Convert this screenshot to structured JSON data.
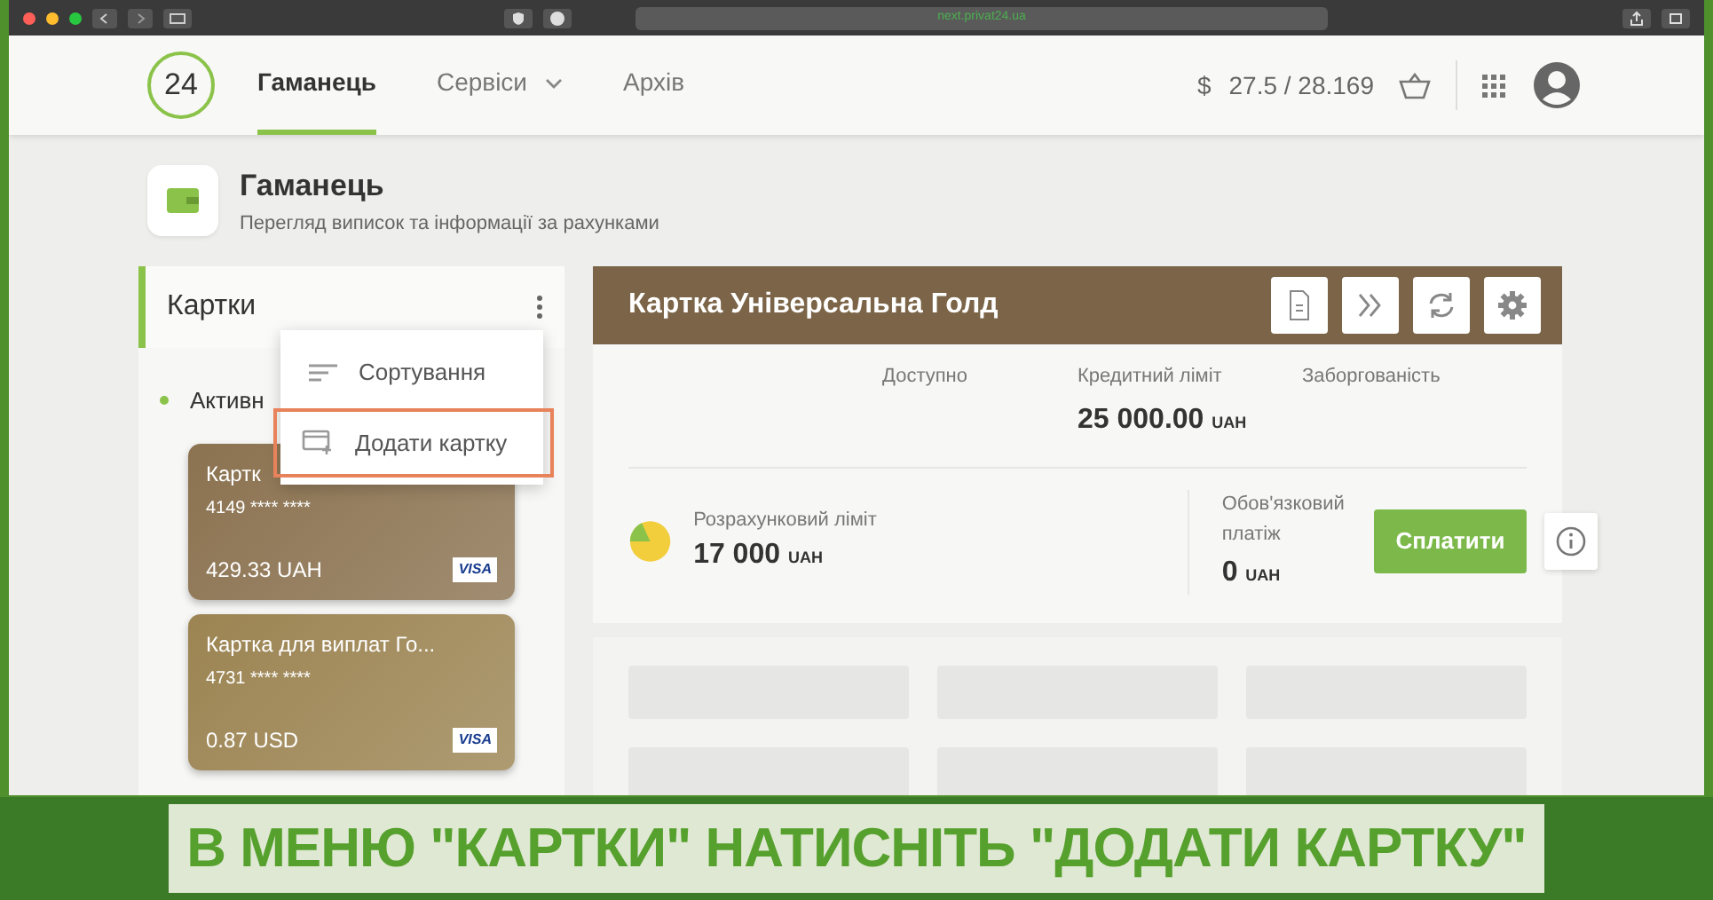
{
  "browser": {
    "url": "next.privat24.ua"
  },
  "nav": {
    "logo": "24",
    "tabs": [
      {
        "label": "Гаманець",
        "selected": true,
        "dropdown": false
      },
      {
        "label": "Сервіси",
        "selected": false,
        "dropdown": true
      },
      {
        "label": "Архів",
        "selected": false,
        "dropdown": false
      }
    ],
    "rate_symbol": "$",
    "rate": "27.5 / 28.169"
  },
  "page_header": {
    "title": "Гаманець",
    "subtitle": "Перегляд виписок та інформації за рахунками"
  },
  "cards_panel": {
    "title": "Картки",
    "filter": "Активн",
    "menu": {
      "items": [
        {
          "kind": "sort",
          "label": "Сортування",
          "highlighted": false
        },
        {
          "kind": "add",
          "label": "Додати картку",
          "highlighted": true
        }
      ]
    },
    "cards": [
      {
        "name": "Картк",
        "number": "4149 **** ****",
        "balance": "429.33 UAH",
        "brand": "VISA",
        "color": "#8b7250"
      },
      {
        "name": "Картка для виплат Го...",
        "number": "4731 **** ****",
        "balance": "0.87 USD",
        "brand": "VISA",
        "color": "#9c8452"
      }
    ]
  },
  "card_detail": {
    "title": "Картка Універсальна Голд",
    "stats": [
      {
        "label": "Доступно"
      },
      {
        "label": "Кредитний ліміт",
        "amount": "25 000.00",
        "currency": "UAH"
      },
      {
        "label": "Заборгованість"
      }
    ],
    "settlement": {
      "label": "Розрахунковий ліміт",
      "amount": "17 000",
      "currency": "UAH"
    },
    "payment": {
      "label": "Обов'язковий платіж",
      "amount": "0",
      "currency": "UAH"
    },
    "pay_button": "Сплатити"
  },
  "caption": "В МЕНЮ \"КАРТКИ\" НАТИСНІТЬ \"ДОДАТИ КАРТКУ\""
}
